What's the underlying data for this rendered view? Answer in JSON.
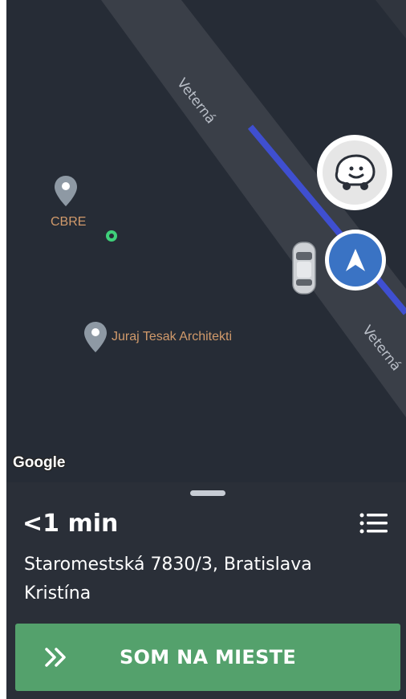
{
  "map": {
    "street_labels": [
      "Veterná",
      "Veterná"
    ],
    "pois": [
      {
        "label": "CBRE",
        "icon": "map-pin-icon"
      },
      {
        "label": "Juraj Tesak Architekti",
        "icon": "map-pin-icon"
      }
    ],
    "provider_logo": "Google",
    "colors": {
      "background": "#262c36",
      "road": "#3a3f48",
      "route": "#3f4fd0",
      "poi_label": "#d19a6b",
      "location_dot": "#3fd07a"
    }
  },
  "controls": {
    "waze_icon": "waze-icon",
    "recenter_icon": "navigation-arrow-icon"
  },
  "trip": {
    "eta": "<1 min",
    "menu_icon": "list-icon",
    "address": "Staromestská 7830/3, Bratislava",
    "passenger": "Kristína"
  },
  "action": {
    "label": "SOM NA MIESTE",
    "icon": "double-chevron-right-icon",
    "color": "#54a16c"
  }
}
